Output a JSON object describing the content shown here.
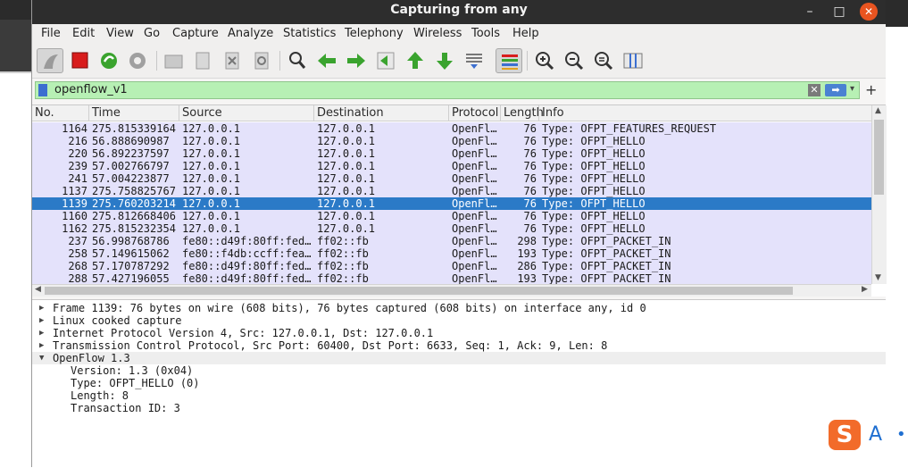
{
  "window": {
    "title": "Capturing from any",
    "controls": [
      "–",
      "□",
      "✕"
    ]
  },
  "menu": [
    "File",
    "Edit",
    "View",
    "Go",
    "Capture",
    "Analyze",
    "Statistics",
    "Telephony",
    "Wireless",
    "Tools",
    "Help"
  ],
  "toolbar": {
    "icons": [
      "shark-fin-start-icon",
      "stop-capture-icon",
      "restart-capture-icon",
      "capture-options-icon",
      "open-file-icon",
      "save-file-icon",
      "close-file-icon",
      "reload-file-icon",
      "find-packet-icon",
      "go-back-icon",
      "go-forward-icon",
      "go-to-packet-icon",
      "go-first-icon",
      "go-last-icon",
      "auto-scroll-icon",
      "colorize-icon",
      "zoom-in-icon",
      "zoom-out-icon",
      "normal-size-icon",
      "resize-columns-icon"
    ],
    "colors": {
      "stop": "#d81c1c",
      "green": "#3aa32e",
      "blue": "#3c6fd0"
    }
  },
  "filter": {
    "value": "openflow_v1",
    "plus": "+"
  },
  "packet_list": {
    "columns": [
      "No.",
      "Time",
      "Source",
      "Destination",
      "Protocol",
      "Length",
      "Info"
    ],
    "rows": [
      {
        "no": "1164",
        "time": "275.815339164",
        "src": "127.0.0.1",
        "dst": "127.0.0.1",
        "proto": "OpenFl…",
        "len": "76",
        "info": "Type: OFPT_FEATURES_REQUEST"
      },
      {
        "no": "216",
        "time": "56.888690987",
        "src": "127.0.0.1",
        "dst": "127.0.0.1",
        "proto": "OpenFl…",
        "len": "76",
        "info": "Type: OFPT_HELLO"
      },
      {
        "no": "220",
        "time": "56.892237597",
        "src": "127.0.0.1",
        "dst": "127.0.0.1",
        "proto": "OpenFl…",
        "len": "76",
        "info": "Type: OFPT_HELLO"
      },
      {
        "no": "239",
        "time": "57.002766797",
        "src": "127.0.0.1",
        "dst": "127.0.0.1",
        "proto": "OpenFl…",
        "len": "76",
        "info": "Type: OFPT_HELLO"
      },
      {
        "no": "241",
        "time": "57.004223877",
        "src": "127.0.0.1",
        "dst": "127.0.0.1",
        "proto": "OpenFl…",
        "len": "76",
        "info": "Type: OFPT_HELLO"
      },
      {
        "no": "1137",
        "time": "275.758825767",
        "src": "127.0.0.1",
        "dst": "127.0.0.1",
        "proto": "OpenFl…",
        "len": "76",
        "info": "Type: OFPT_HELLO"
      },
      {
        "no": "1139",
        "time": "275.760203214",
        "src": "127.0.0.1",
        "dst": "127.0.0.1",
        "proto": "OpenFl…",
        "len": "76",
        "info": "Type: OFPT_HELLO",
        "selected": true
      },
      {
        "no": "1160",
        "time": "275.812668406",
        "src": "127.0.0.1",
        "dst": "127.0.0.1",
        "proto": "OpenFl…",
        "len": "76",
        "info": "Type: OFPT_HELLO"
      },
      {
        "no": "1162",
        "time": "275.815232354",
        "src": "127.0.0.1",
        "dst": "127.0.0.1",
        "proto": "OpenFl…",
        "len": "76",
        "info": "Type: OFPT_HELLO"
      },
      {
        "no": "237",
        "time": "56.998768786",
        "src": "fe80::d49f:80ff:fed…",
        "dst": "ff02::fb",
        "proto": "OpenFl…",
        "len": "298",
        "info": "Type: OFPT_PACKET_IN"
      },
      {
        "no": "258",
        "time": "57.149615062",
        "src": "fe80::f4db:ccff:fea…",
        "dst": "ff02::fb",
        "proto": "OpenFl…",
        "len": "193",
        "info": "Type: OFPT_PACKET_IN"
      },
      {
        "no": "268",
        "time": "57.170787292",
        "src": "fe80::d49f:80ff:fed…",
        "dst": "ff02::fb",
        "proto": "OpenFl…",
        "len": "286",
        "info": "Type: OFPT_PACKET_IN"
      },
      {
        "no": "288",
        "time": "57.427196055",
        "src": "fe80::d49f:80ff:fed…",
        "dst": "ff02::fb",
        "proto": "OpenFl…",
        "len": "193",
        "info": "Type: OFPT_PACKET_IN"
      }
    ],
    "colors": {
      "row": "#e4e2fb",
      "selected": "#2b7ac7"
    }
  },
  "details": [
    {
      "text": "Frame 1139: 76 bytes on wire (608 bits), 76 bytes captured (608 bits) on interface any, id 0",
      "expanded": false
    },
    {
      "text": "Linux cooked capture",
      "expanded": false
    },
    {
      "text": "Internet Protocol Version 4, Src: 127.0.0.1, Dst: 127.0.0.1",
      "expanded": false
    },
    {
      "text": "Transmission Control Protocol, Src Port: 60400, Dst Port: 6633, Seq: 1, Ack: 9, Len: 8",
      "expanded": false
    },
    {
      "text": "OpenFlow 1.3",
      "expanded": true
    },
    {
      "text": "Version: 1.3 (0x04)",
      "child": true
    },
    {
      "text": "Type: OFPT_HELLO (0)",
      "child": true
    },
    {
      "text": "Length: 8",
      "child": true
    },
    {
      "text": "Transaction ID: 3",
      "child": true
    }
  ],
  "ime": {
    "logo": "S",
    "mode": "A",
    "dot": "•"
  }
}
